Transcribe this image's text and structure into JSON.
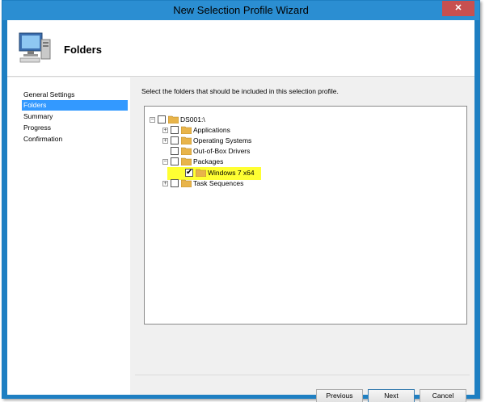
{
  "window": {
    "title": "New Selection Profile Wizard",
    "close_glyph": "✕"
  },
  "header": {
    "title": "Folders",
    "icon": "computer-icon"
  },
  "nav": {
    "items": [
      {
        "label": "General Settings",
        "selected": false
      },
      {
        "label": "Folders",
        "selected": true
      },
      {
        "label": "Summary",
        "selected": false
      },
      {
        "label": "Progress",
        "selected": false
      },
      {
        "label": "Confirmation",
        "selected": false
      }
    ]
  },
  "content": {
    "instruction": "Select the folders that should be included in this selection profile.",
    "tree": {
      "root": {
        "label": "DS001:\\",
        "checked": false
      },
      "items": [
        {
          "label": "Applications",
          "checked": false
        },
        {
          "label": "Operating Systems",
          "checked": false
        },
        {
          "label": "Out-of-Box Drivers",
          "checked": false
        },
        {
          "label": "Packages",
          "checked": false
        },
        {
          "label": "Windows 7 x64",
          "checked": true,
          "highlighted": true
        },
        {
          "label": "Task Sequences",
          "checked": false
        }
      ]
    }
  },
  "buttons": {
    "previous": "Previous",
    "next": "Next",
    "cancel": "Cancel"
  },
  "colors": {
    "titlebar": "#2b8ed2",
    "nav_selected": "#3399ff",
    "highlight": "#ffff33",
    "close": "#c75050"
  }
}
